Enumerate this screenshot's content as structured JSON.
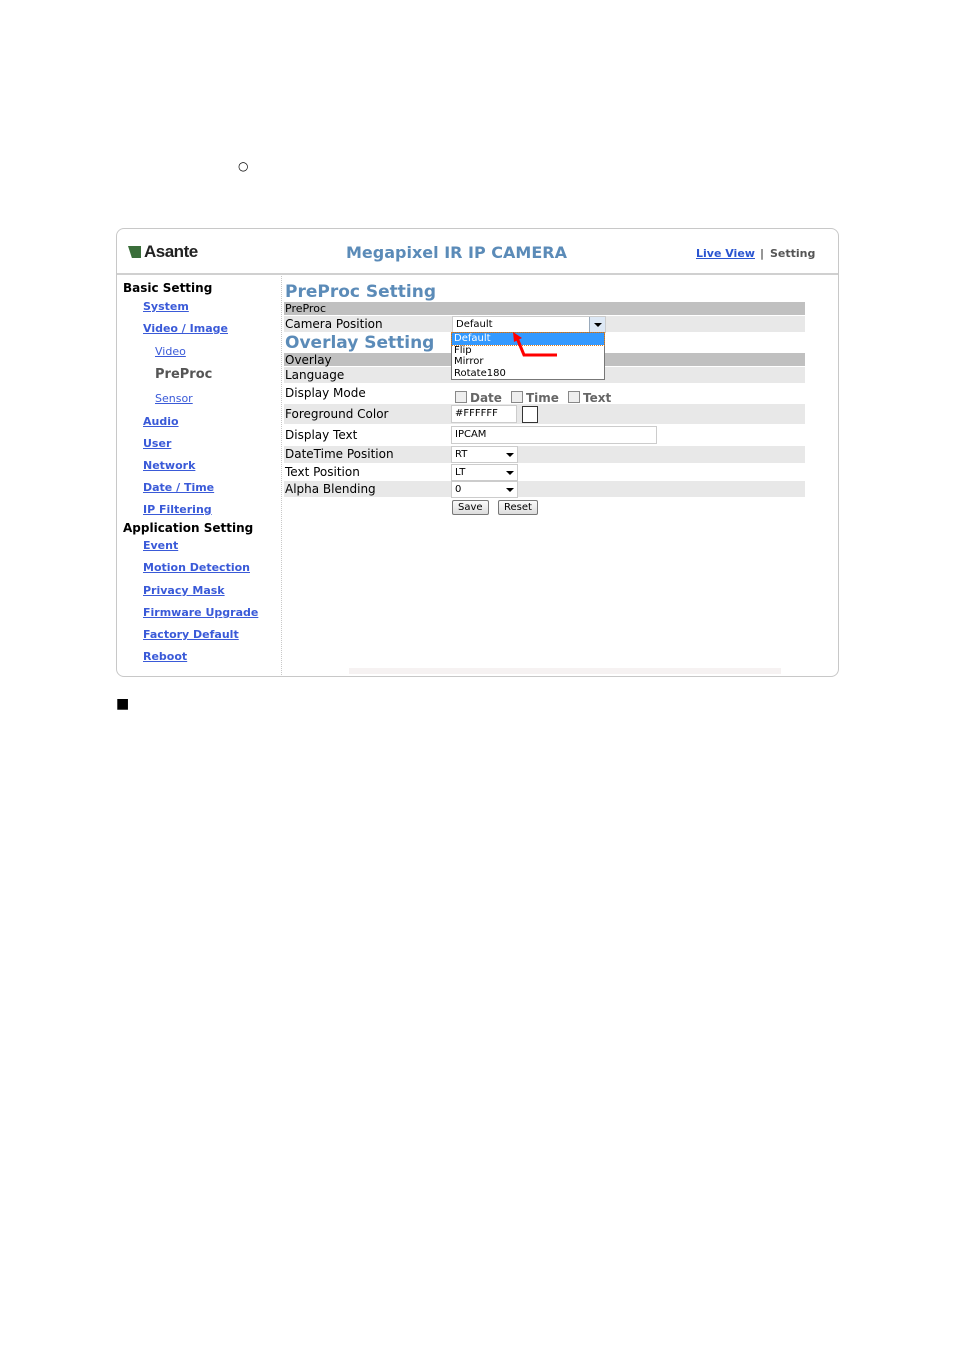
{
  "doc": {
    "bullet_circle": "○",
    "bullet_square": "■"
  },
  "header": {
    "logo": "Asante",
    "title": "Megapixel IR IP CAMERA",
    "live_view": "Live View",
    "separator": "|",
    "setting": "Setting"
  },
  "sidebar": {
    "basic_heading": "Basic Setting",
    "system": "System",
    "video_image": "Video / Image",
    "video": "Video",
    "preproc": "PreProc",
    "sensor": "Sensor",
    "audio": "Audio",
    "user": "User",
    "network": "Network",
    "date_time": "Date / Time",
    "ip_filtering": "IP Filtering",
    "app_heading": "Application Setting",
    "event": "Event",
    "motion": "Motion Detection",
    "privacy": "Privacy Mask",
    "firmware": "Firmware Upgrade",
    "factory": "Factory Default",
    "reboot": "Reboot"
  },
  "main": {
    "preproc_title": "PreProc Setting",
    "preproc_header": "PreProc",
    "camera_position_label": "Camera Position",
    "camera_position_value": "Default",
    "camera_position_options": [
      "Default",
      "Flip",
      "Mirror",
      "Rotate180"
    ],
    "overlay_title": "Overlay Setting",
    "overlay_header": "Overlay",
    "language_label": "Language",
    "display_mode_label": "Display Mode",
    "mode_date": "Date",
    "mode_time": "Time",
    "mode_text": "Text",
    "fg_color_label": "Foreground Color",
    "fg_color_value": "#FFFFFF",
    "display_text_label": "Display Text",
    "display_text_value": "IPCAM",
    "datetime_pos_label": "DateTime Position",
    "datetime_pos_value": "RT",
    "text_pos_label": "Text Position",
    "text_pos_value": "LT",
    "alpha_label": "Alpha Blending",
    "alpha_value": "0",
    "save": "Save",
    "reset": "Reset"
  },
  "colors": {
    "accent": "#5b8bb8",
    "link": "#3a5ad8",
    "annotation_arrow": "#ff0000",
    "highlight": "#3399ff"
  }
}
